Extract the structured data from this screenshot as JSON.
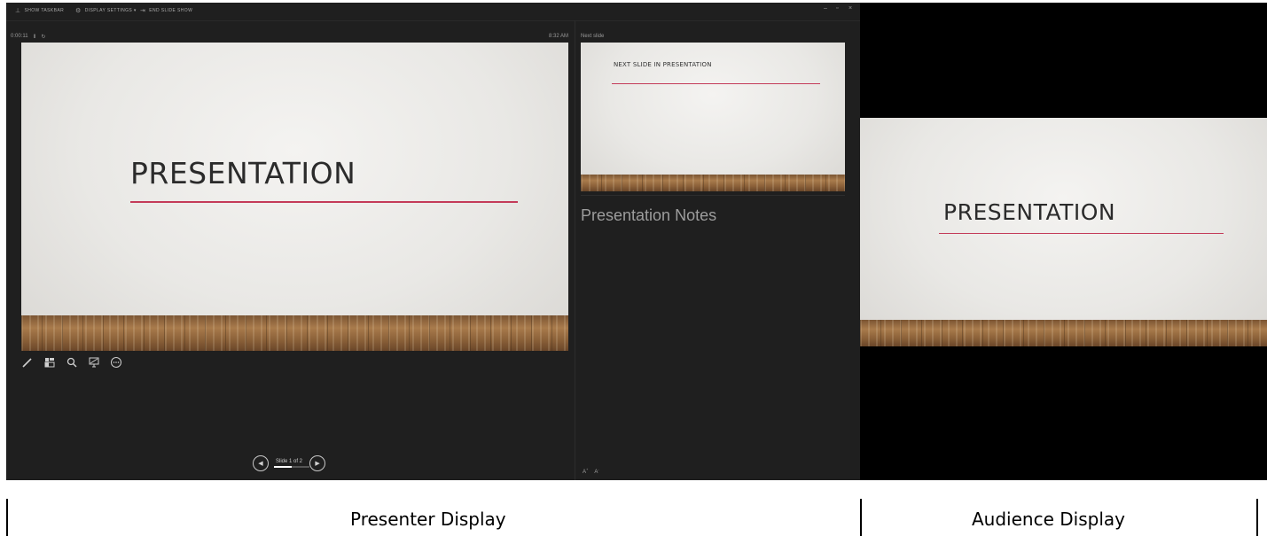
{
  "presenter": {
    "toolbar": {
      "show_taskbar": "SHOW TASKBAR",
      "display_settings": "DISPLAY SETTINGS ▾",
      "end_slide_show": "END SLIDE SHOW"
    },
    "window_controls": {
      "minimize": "–",
      "restore": "▫",
      "close": "×"
    },
    "timer": "0:00:11",
    "pause_icon": "Ⅱ",
    "reset_icon": "↻",
    "clock": "8:32 AM",
    "current_slide": {
      "title": "PRESENTATION"
    },
    "slide_counter": "Slide 1 of 2",
    "slide_progress": 0.5,
    "next_label": "Next slide",
    "next_slide": {
      "title": "NEXT SLIDE IN PRESENTATION"
    },
    "notes": "Presentation Notes",
    "font_increase": "A",
    "font_decrease": "A"
  },
  "audience": {
    "slide": {
      "title": "PRESENTATION"
    }
  },
  "labels": {
    "presenter": "Presenter Display",
    "audience": "Audience Display"
  },
  "colors": {
    "accent_line": "#c43b59",
    "presenter_bg": "#1f1f1f",
    "audience_bg": "#000000"
  }
}
